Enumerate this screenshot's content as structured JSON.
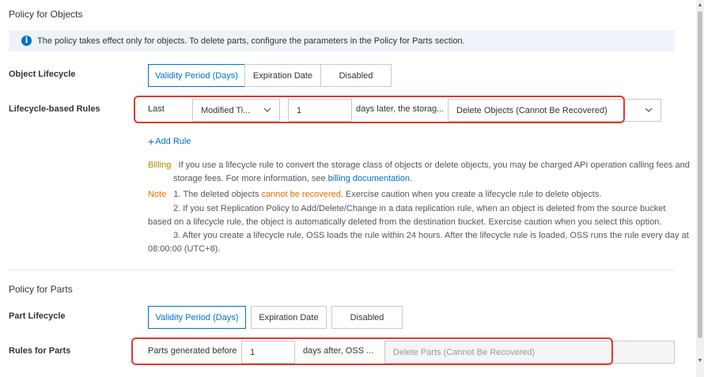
{
  "objects_section": {
    "title": "Policy for Objects",
    "info_text": "The policy takes effect only for objects. To delete parts, configure the parameters in the Policy for Parts section.",
    "lifecycle_label": "Object Lifecycle",
    "lifecycle_options": [
      "Validity Period (Days)",
      "Expiration Date",
      "Disabled"
    ],
    "lifecycle_selected": "Validity Period (Days)",
    "rules_label": "Lifecycle-based Rules",
    "rule": {
      "prefix": "Last",
      "time_select": "Modified Ti...",
      "days_value": "1",
      "days_suffix": "days later, the storag...",
      "action_select": "Delete Objects (Cannot Be Recovered)"
    },
    "add_rule": "Add Rule",
    "billing_tag": "Billing",
    "billing_line1": "If you use a lifecycle rule to convert the storage class of objects or delete objects, you may be charged API operation calling fees and",
    "billing_line2_pre": "storage fees. For more information, see ",
    "billing_link": "billing documentation",
    "billing_line2_post": ".",
    "note_tag": "Note",
    "note1_pre": "1. The deleted objects ",
    "note1_warn": "cannot be recovered",
    "note1_post": ". Exercise caution when you create a lifecycle rule to delete objects.",
    "note2_line1": "2. If you set Replication Policy to Add/Delete/Change in a data replication rule, when an object is deleted from the source bucket",
    "note2_line2": "based on a lifecycle rule, the object is automatically deleted from the destination bucket. Exercise caution when you select this option.",
    "note3_line1": "3. After you create a lifecycle rule, OSS loads the rule within 24 hours. After the lifecycle rule is loaded, OSS runs the rule every day at",
    "note3_line2": "08:00:00 (UTC+8)."
  },
  "parts_section": {
    "title": "Policy for Parts",
    "lifecycle_label": "Part Lifecycle",
    "lifecycle_options": [
      "Validity Period (Days)",
      "Expiration Date",
      "Disabled"
    ],
    "lifecycle_selected": "Validity Period (Days)",
    "rules_label": "Rules for Parts",
    "rule": {
      "prefix": "Parts generated before",
      "days_value": "1",
      "days_suffix": "days after, OSS ...",
      "action_placeholder": "Delete Parts (Cannot Be Recovered)"
    }
  },
  "icons": {
    "info": "info-icon",
    "chevron": "chevron-down-icon",
    "plus": "plus-icon"
  },
  "colors": {
    "accent": "#0070cc",
    "highlight_outline": "#e03a2f",
    "billing": "#b48800",
    "note": "#ef6c00",
    "info_bg": "#eef3f9"
  }
}
